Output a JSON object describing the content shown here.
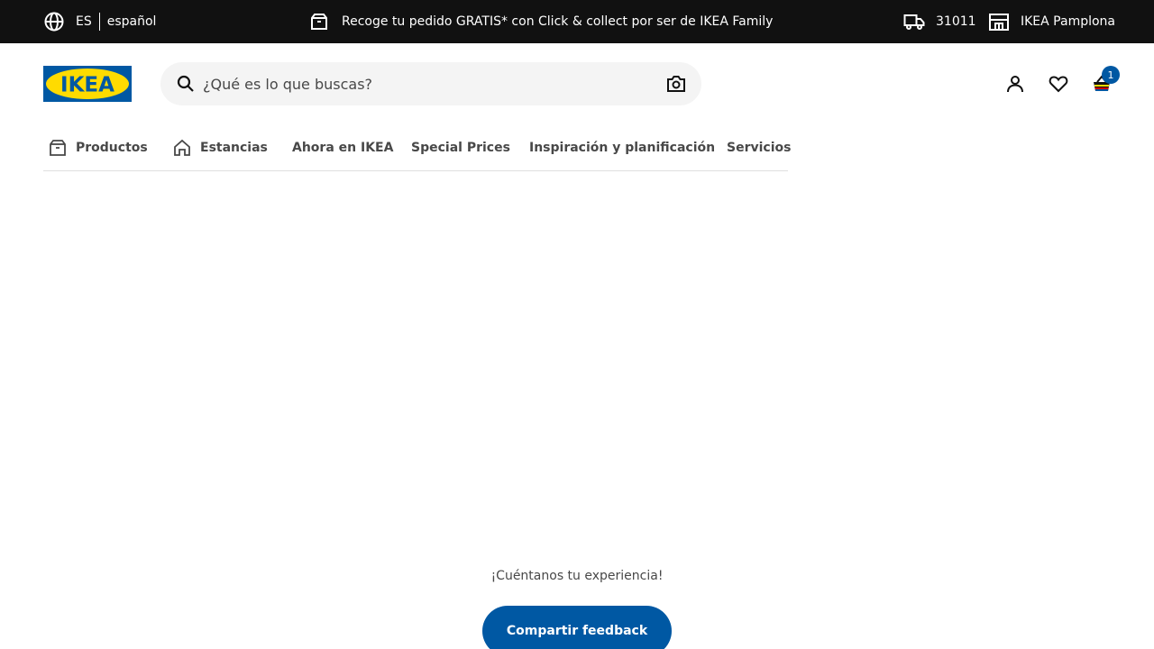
{
  "top_banner": {
    "language_code": "ES",
    "language_name": "español",
    "promo_text": "Recoge tu pedido GRATIS* con Click & collect por ser de IKEA Family",
    "postal_code": "31011",
    "store_name": "IKEA Pamplona"
  },
  "header": {
    "logo_text": "IKEA",
    "search_placeholder": "¿Qué es lo que buscas?",
    "cart_count": "1"
  },
  "nav": {
    "tabs": [
      {
        "label": "Productos",
        "icon": "box-icon"
      },
      {
        "label": "Estancias",
        "icon": "home-icon"
      },
      {
        "label": "Ahora en IKEA"
      },
      {
        "label": "Special Prices"
      },
      {
        "label": "Inspiración y planificación"
      },
      {
        "label": "Servicios"
      }
    ]
  },
  "feedback": {
    "prompt": "¡Cuéntanos tu experiencia!",
    "button_label": "Compartir feedback"
  },
  "colors": {
    "banner_bg": "#111111",
    "brand_blue": "#0058a3",
    "brand_yellow": "#ffdb00",
    "search_bg": "#f4f4f4"
  }
}
